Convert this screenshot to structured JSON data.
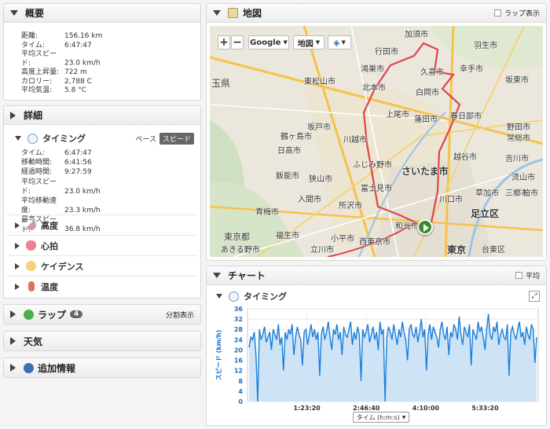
{
  "summary": {
    "title": "概要",
    "rows": [
      {
        "k": "距離:",
        "v": "156.16 km"
      },
      {
        "k": "タイム:",
        "v": "6:47:47"
      },
      {
        "k": "平均スピード:",
        "v": "23.0 km/h"
      },
      {
        "k": "高度上昇量:",
        "v": "722 m"
      },
      {
        "k": "カロリー:",
        "v": "2,788 C"
      },
      {
        "k": "平均気温:",
        "v": "5.8 °C"
      }
    ]
  },
  "details": {
    "title": "詳細",
    "timing_label": "タイミング",
    "pace_label": "ペース",
    "speed_label": "スピード",
    "timing_rows": [
      {
        "k": "タイム:",
        "v": "6:47:47"
      },
      {
        "k": "移動時間:",
        "v": "6:41:56"
      },
      {
        "k": "経過時間:",
        "v": "9:27:59"
      },
      {
        "k": "平均スピード:",
        "v": "23.0 km/h"
      },
      {
        "k": "平均移動速度:",
        "v": "23.3 km/h"
      },
      {
        "k": "最高スピード:",
        "v": "36.8 km/h"
      }
    ],
    "sections": [
      "高度",
      "心拍",
      "ケイデンス",
      "温度"
    ]
  },
  "laps": {
    "title": "ラップ",
    "count": "4",
    "split_label": "分割表示"
  },
  "weather": {
    "title": "天気"
  },
  "extra": {
    "title": "追加情報"
  },
  "map": {
    "title": "地図",
    "lap_label": "ラップ表示",
    "provider": "Google",
    "maptype": "地図",
    "labels": [
      "加須市",
      "羽生市",
      "行田市",
      "鴻巣市",
      "久喜市",
      "幸手市",
      "坂東市",
      "東松山市",
      "北本市",
      "白岡市",
      "上尾市",
      "蓮田市",
      "春日部市",
      "野田市",
      "坂戸市",
      "川越市",
      "さいたま市",
      "越谷市",
      "流山市",
      "ふじみ野市",
      "川口市",
      "入間市",
      "富士見市",
      "足立区",
      "所沢市",
      "青梅市",
      "和光市",
      "東京都",
      "福生市",
      "東京",
      "台東区",
      "あきる野市",
      "立川市",
      "小平市",
      "西東京市",
      "鶴ヶ島市",
      "日高市",
      "飯能市",
      "狭山市",
      "吉川市",
      "三郷市",
      "草加市",
      "柏市",
      "玉県",
      "常総市"
    ]
  },
  "chart": {
    "title": "チャート",
    "avg_label": "平均",
    "timing_label": "タイミング",
    "xaxis_select": "タイム (h:m:s)"
  },
  "chart_data": {
    "type": "area",
    "ylabel": "スピード (km/h)",
    "ylim": [
      0,
      36
    ],
    "yticks": [
      0,
      4,
      8,
      12,
      16,
      20,
      24,
      28,
      32,
      36
    ],
    "xticks": [
      "1:23:20",
      "2:46:40",
      "4:10:00",
      "5:33:20"
    ],
    "color": "#1a7fd8",
    "x_seconds_max": 24467,
    "values": [
      21,
      25,
      24,
      27,
      18,
      0,
      28,
      24,
      26,
      29,
      23,
      25,
      27,
      20,
      28,
      26,
      24,
      30,
      22,
      25,
      12,
      27,
      24,
      28,
      26,
      30,
      18,
      25,
      29,
      26,
      24,
      14,
      27,
      28,
      22,
      26,
      30,
      25,
      28,
      24,
      27,
      10,
      26,
      29,
      24,
      27,
      31,
      25,
      20,
      28,
      26,
      30,
      24,
      27,
      18,
      29,
      26,
      25,
      28,
      31,
      22,
      27,
      24,
      29,
      26,
      8,
      28,
      25,
      27,
      30,
      23,
      26,
      29,
      24,
      27,
      20,
      31,
      26,
      28,
      0,
      25,
      29,
      27,
      24,
      30,
      26,
      22,
      28,
      25,
      31,
      27,
      24,
      16,
      28,
      30,
      26,
      25,
      29,
      23,
      27,
      32,
      25,
      28,
      12,
      26,
      30,
      24,
      29,
      27,
      25,
      21,
      28,
      31,
      26,
      24,
      29,
      18,
      27,
      25,
      30,
      28,
      24,
      33,
      26,
      22,
      29,
      27,
      25,
      30,
      14,
      28,
      26,
      24,
      31,
      27,
      29,
      25,
      20,
      28,
      34,
      26,
      24,
      29,
      27,
      31,
      22,
      26,
      28,
      25,
      24,
      30,
      10,
      27,
      29,
      26,
      24,
      28,
      31,
      25,
      27,
      22,
      29,
      26,
      24,
      30,
      28,
      15,
      25
    ]
  }
}
